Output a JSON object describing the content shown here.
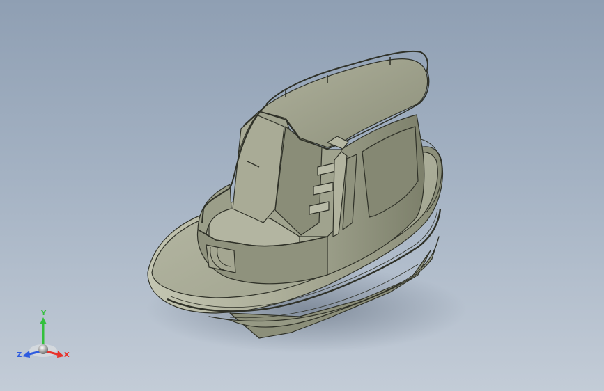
{
  "colors": {
    "background_top": "#8f9fb3",
    "background_bottom": "#c3ccd7",
    "hull": "#a7a994",
    "hull_dark": "#7f826d",
    "edge": "#2f3128",
    "axis_x": "#e8322b",
    "axis_y": "#33c03c",
    "axis_z": "#2d5be0"
  },
  "triad": {
    "x_label": "X",
    "y_label": "Y",
    "z_label": "Z"
  }
}
